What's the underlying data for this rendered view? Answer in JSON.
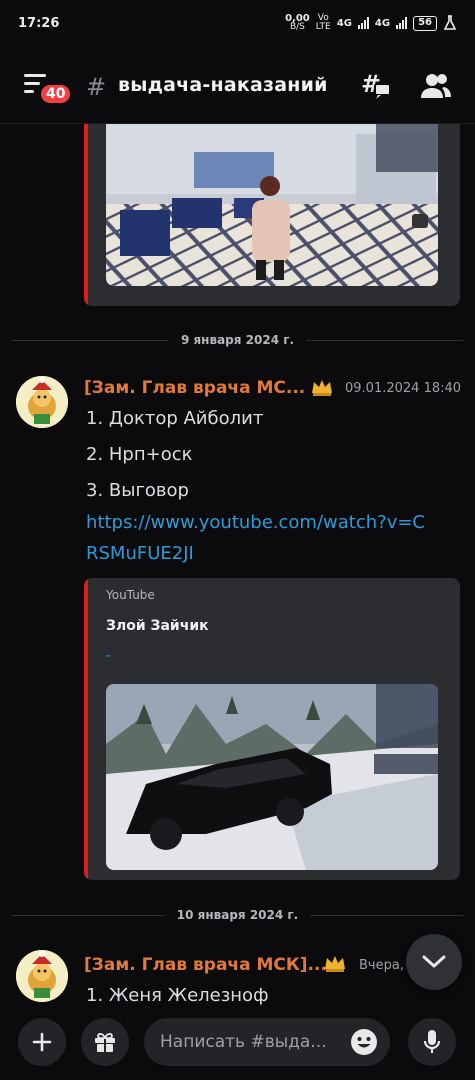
{
  "status_bar": {
    "time": "17:26",
    "net_speed": "0,00",
    "net_unit": "B/S",
    "volte_top": "Vo",
    "volte_bottom": "LTE",
    "signal1": "4G",
    "signal2": "4G",
    "battery": "56"
  },
  "header": {
    "badge_count": "40",
    "channel_name": "выдача-наказаний"
  },
  "messages": [
    {
      "date_divider": "9 января 2024 г.",
      "author": "[Зам. Глав врача МС...",
      "timestamp": "09.01.2024 18:40",
      "items": [
        "1.  Доктор Айболит",
        "2.  Нрп+оск",
        "3.  Выговор"
      ],
      "link": "https://www.youtube.com/watch?v=CRSMuFUE2JI",
      "embed": {
        "provider": "YouTube",
        "title": "Злой Зайчик",
        "description": "-"
      }
    },
    {
      "date_divider": "10 января 2024 г.",
      "author": "[Зам. Глав врача МСК]...",
      "timestamp": "Вчера,",
      "items": [
        "1.  Женя Железноф"
      ]
    }
  ],
  "composer": {
    "placeholder": "Написать #выда..."
  },
  "icons": {
    "menu": "menu-icon",
    "hash": "hash-icon",
    "threads": "threads-icon",
    "members": "members-icon",
    "crown": "crown-icon",
    "scroll": "chevron-down-icon",
    "plus": "plus-icon",
    "gift": "gift-icon",
    "emoji": "emoji-icon",
    "mic": "mic-icon"
  },
  "colors": {
    "background": "#0b0b0d",
    "author": "#e2793b",
    "link": "#2a9dd8",
    "badge": "#f23f43",
    "embed_bar": "#e01b1b",
    "embed_bg": "#2b2d31"
  }
}
